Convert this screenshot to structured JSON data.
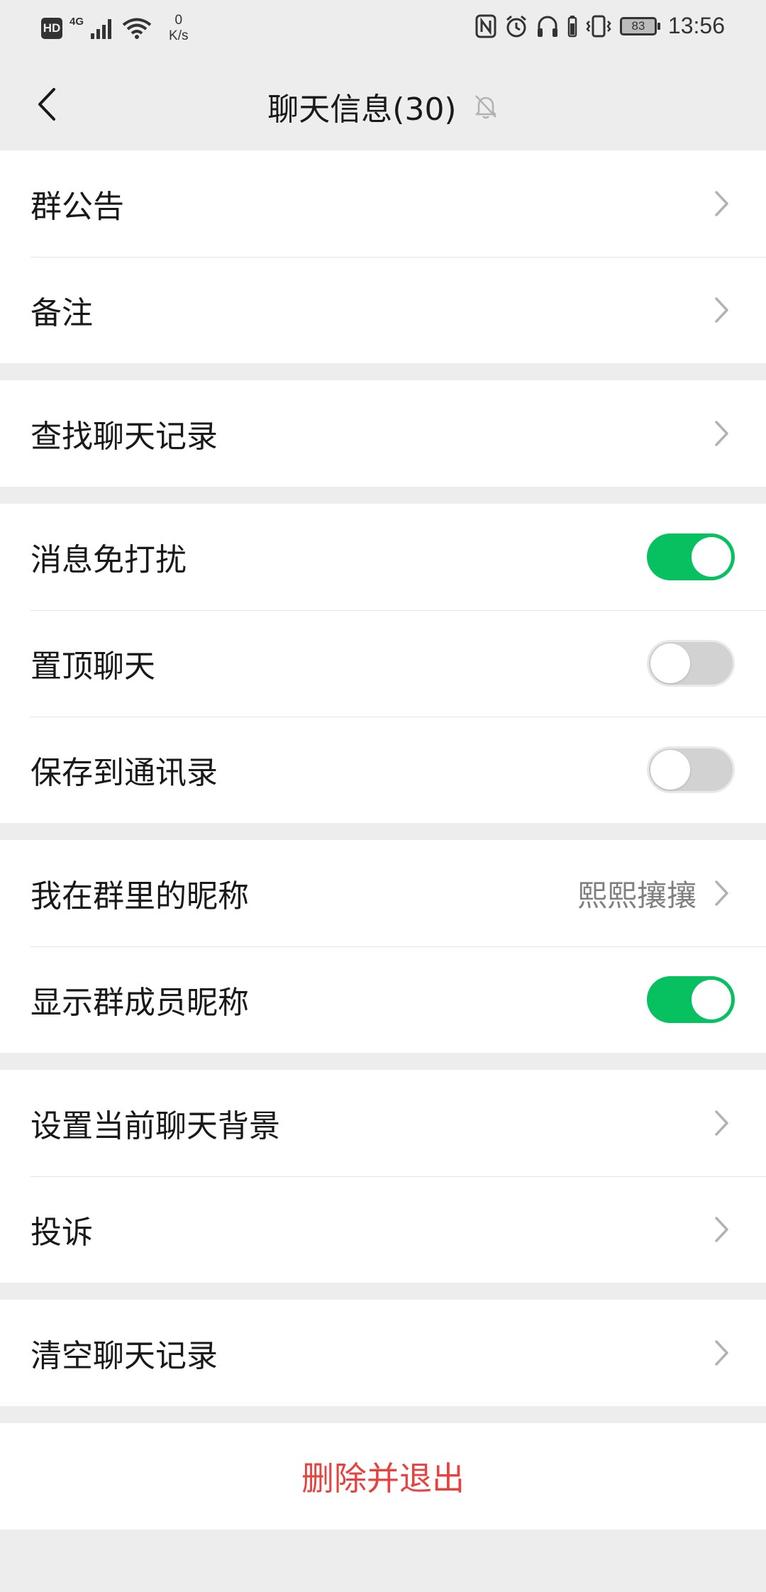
{
  "status_bar": {
    "hd": "HD",
    "network": "4G",
    "speed_value": "0",
    "speed_unit": "K/s",
    "battery": "83",
    "time": "13:56"
  },
  "nav": {
    "title": "聊天信息(30)"
  },
  "groups": {
    "g1": [
      "群公告",
      "备注"
    ],
    "g2": [
      "查找聊天记录"
    ],
    "g3": {
      "mute": {
        "label": "消息免打扰",
        "on": true
      },
      "sticky": {
        "label": "置顶聊天",
        "on": false
      },
      "save_contacts": {
        "label": "保存到通讯录",
        "on": false
      }
    },
    "g4": {
      "my_nickname": {
        "label": "我在群里的昵称",
        "value": "熙熙攘攘"
      },
      "show_nicknames": {
        "label": "显示群成员昵称",
        "on": true
      }
    },
    "g5": [
      "设置当前聊天背景",
      "投诉"
    ],
    "g6": [
      "清空聊天记录"
    ]
  },
  "delete_exit": "删除并退出",
  "colors": {
    "accent_green": "#07c160",
    "danger_red": "#e64340",
    "background": "#ededed"
  }
}
